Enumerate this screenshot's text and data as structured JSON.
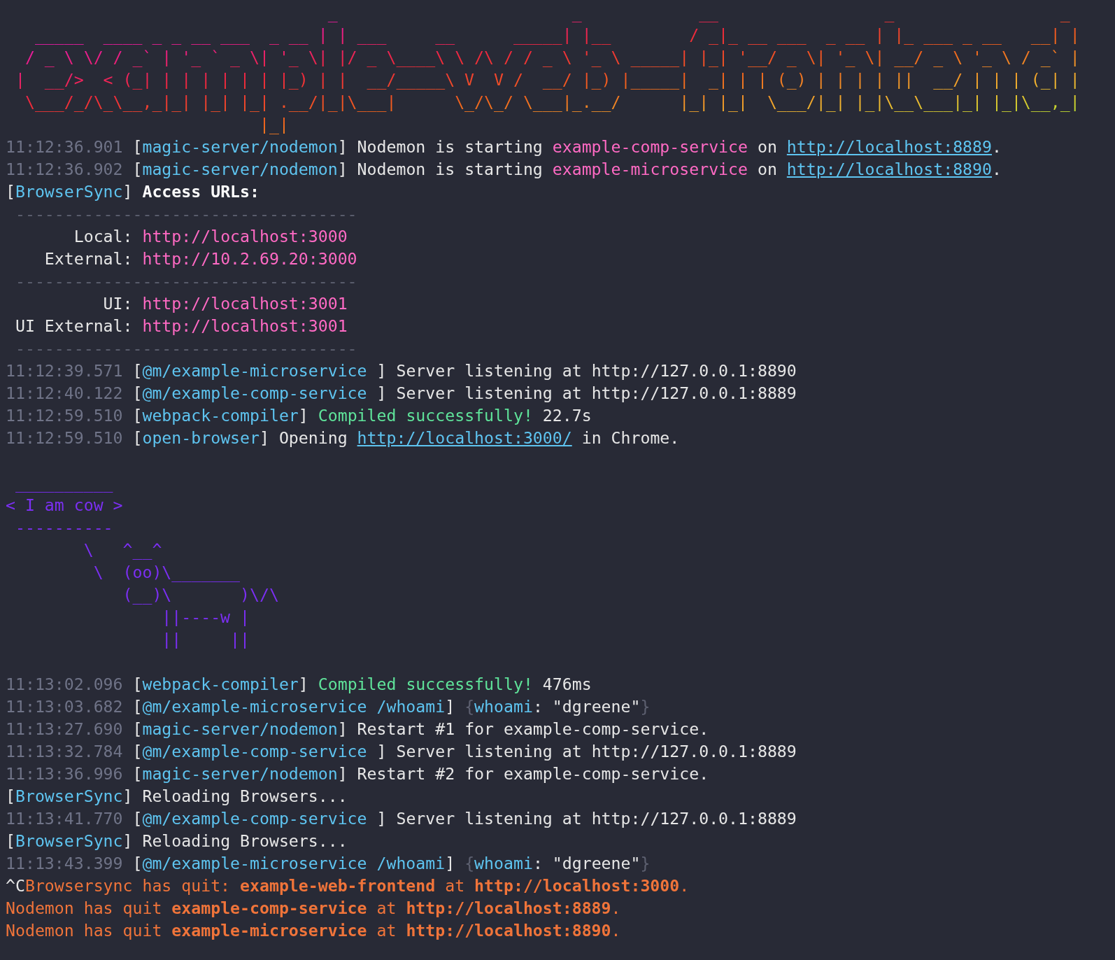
{
  "banner": [
    "                                 _                        _            __                 _                 _",
    "   _____  ____ _ _ __ ___  _ __ | | ___     __      _____| |__        / _|_ __ ___  _ __ | |_ ___ _ __   __| |",
    "  / _ \\ \\/ / _` | '_ ` _ \\| '_ \\| |/ _ \\____\\ \\ /\\ / / _ \\ '_ \\ _____| |_| '__/ _ \\| '_ \\| __/ _ \\ '_ \\ / _` |",
    " |  __/>  < (_| | | | | | | |_) | |  __/_____\\ V  V /  __/ |_) |_____|  _| | | (_) | | | | ||  __/ | | | (_| |",
    "  \\___/_/\\_\\__,_|_| |_| |_| .__/|_|\\___|      \\_/\\_/ \\___|_.__/      |_| |_|  \\___/|_| |_|\\__\\___|_| |_|\\__,_|",
    "                          |_|"
  ],
  "lines": [
    {
      "kind": "log",
      "segments": [
        {
          "kind": "time",
          "text": "11:12:36.901"
        },
        {
          "kind": "plain",
          "text": " ["
        },
        {
          "kind": "tag",
          "text": "magic-server/nodemon"
        },
        {
          "kind": "plain",
          "text": "] Nodemon is starting "
        },
        {
          "kind": "pink",
          "text": "example-comp-service"
        },
        {
          "kind": "plain",
          "text": " on "
        },
        {
          "kind": "link",
          "text": "http://localhost:8889"
        },
        {
          "kind": "plain",
          "text": "."
        }
      ]
    },
    {
      "kind": "log",
      "segments": [
        {
          "kind": "time",
          "text": "11:12:36.902"
        },
        {
          "kind": "plain",
          "text": " ["
        },
        {
          "kind": "tag",
          "text": "magic-server/nodemon"
        },
        {
          "kind": "plain",
          "text": "] Nodemon is starting "
        },
        {
          "kind": "pink",
          "text": "example-microservice"
        },
        {
          "kind": "plain",
          "text": " on "
        },
        {
          "kind": "link",
          "text": "http://localhost:8890"
        },
        {
          "kind": "plain",
          "text": "."
        }
      ]
    },
    {
      "kind": "log",
      "segments": [
        {
          "kind": "plain",
          "text": "["
        },
        {
          "kind": "tag",
          "text": "BrowserSync"
        },
        {
          "kind": "plain",
          "text": "] "
        },
        {
          "kind": "bold",
          "text": "Access URLs:"
        }
      ]
    },
    {
      "kind": "log",
      "segments": [
        {
          "kind": "dim",
          "text": " -----------------------------------"
        }
      ]
    },
    {
      "kind": "log",
      "segments": [
        {
          "kind": "plain",
          "text": "       Local: "
        },
        {
          "kind": "pink",
          "text": "http://localhost:3000"
        }
      ]
    },
    {
      "kind": "log",
      "segments": [
        {
          "kind": "plain",
          "text": "    External: "
        },
        {
          "kind": "pink",
          "text": "http://10.2.69.20:3000"
        }
      ]
    },
    {
      "kind": "log",
      "segments": [
        {
          "kind": "dim",
          "text": " -----------------------------------"
        }
      ]
    },
    {
      "kind": "log",
      "segments": [
        {
          "kind": "plain",
          "text": "          UI: "
        },
        {
          "kind": "pink",
          "text": "http://localhost:3001"
        }
      ]
    },
    {
      "kind": "log",
      "segments": [
        {
          "kind": "plain",
          "text": " UI External: "
        },
        {
          "kind": "pink",
          "text": "http://localhost:3001"
        }
      ]
    },
    {
      "kind": "log",
      "segments": [
        {
          "kind": "dim",
          "text": " -----------------------------------"
        }
      ]
    },
    {
      "kind": "log",
      "segments": [
        {
          "kind": "time",
          "text": "11:12:39.571"
        },
        {
          "kind": "plain",
          "text": " ["
        },
        {
          "kind": "tag",
          "text": "@m/example-microservice"
        },
        {
          "kind": "plain",
          "text": " ] Server listening at http://127.0.0.1:8890"
        }
      ]
    },
    {
      "kind": "log",
      "segments": [
        {
          "kind": "time",
          "text": "11:12:40.122"
        },
        {
          "kind": "plain",
          "text": " ["
        },
        {
          "kind": "tag",
          "text": "@m/example-comp-service"
        },
        {
          "kind": "plain",
          "text": " ] Server listening at http://127.0.0.1:8889"
        }
      ]
    },
    {
      "kind": "log",
      "segments": [
        {
          "kind": "time",
          "text": "11:12:59.510"
        },
        {
          "kind": "plain",
          "text": " ["
        },
        {
          "kind": "tag",
          "text": "webpack-compiler"
        },
        {
          "kind": "plain",
          "text": "] "
        },
        {
          "kind": "green",
          "text": "Compiled successfully!"
        },
        {
          "kind": "plain",
          "text": " 22.7s"
        }
      ]
    },
    {
      "kind": "log",
      "segments": [
        {
          "kind": "time",
          "text": "11:12:59.510"
        },
        {
          "kind": "plain",
          "text": " ["
        },
        {
          "kind": "tag",
          "text": "open-browser"
        },
        {
          "kind": "plain",
          "text": "] Opening "
        },
        {
          "kind": "link",
          "text": "http://localhost:3000/"
        },
        {
          "kind": "plain",
          "text": " in Chrome."
        }
      ]
    },
    {
      "kind": "blank"
    },
    {
      "kind": "cowsay",
      "art": [
        " __________",
        "< I am cow >",
        " ----------",
        "        \\   ^__^",
        "         \\  (oo)\\_______",
        "            (__)\\       )\\/\\",
        "                ||----w |",
        "                ||     ||"
      ]
    },
    {
      "kind": "blank"
    },
    {
      "kind": "log",
      "segments": [
        {
          "kind": "time",
          "text": "11:13:02.096"
        },
        {
          "kind": "plain",
          "text": " ["
        },
        {
          "kind": "tag",
          "text": "webpack-compiler"
        },
        {
          "kind": "plain",
          "text": "] "
        },
        {
          "kind": "green",
          "text": "Compiled successfully!"
        },
        {
          "kind": "plain",
          "text": " 476ms"
        }
      ]
    },
    {
      "kind": "log",
      "segments": [
        {
          "kind": "time",
          "text": "11:13:03.682"
        },
        {
          "kind": "plain",
          "text": " ["
        },
        {
          "kind": "tag",
          "text": "@m/example-microservice /whoami"
        },
        {
          "kind": "plain",
          "text": "] "
        },
        {
          "kind": "dim",
          "text": "{"
        },
        {
          "kind": "tag",
          "text": "whoami"
        },
        {
          "kind": "plain",
          "text": ": \"dgreene\""
        },
        {
          "kind": "dim",
          "text": "}"
        }
      ]
    },
    {
      "kind": "log",
      "segments": [
        {
          "kind": "time",
          "text": "11:13:27.690"
        },
        {
          "kind": "plain",
          "text": " ["
        },
        {
          "kind": "tag",
          "text": "magic-server/nodemon"
        },
        {
          "kind": "plain",
          "text": "] Restart #1 for example-comp-service."
        }
      ]
    },
    {
      "kind": "log",
      "segments": [
        {
          "kind": "time",
          "text": "11:13:32.784"
        },
        {
          "kind": "plain",
          "text": " ["
        },
        {
          "kind": "tag",
          "text": "@m/example-comp-service"
        },
        {
          "kind": "plain",
          "text": " ] Server listening at http://127.0.0.1:8889"
        }
      ]
    },
    {
      "kind": "log",
      "segments": [
        {
          "kind": "time",
          "text": "11:13:36.996"
        },
        {
          "kind": "plain",
          "text": " ["
        },
        {
          "kind": "tag",
          "text": "magic-server/nodemon"
        },
        {
          "kind": "plain",
          "text": "] Restart #2 for example-comp-service."
        }
      ]
    },
    {
      "kind": "log",
      "segments": [
        {
          "kind": "plain",
          "text": "["
        },
        {
          "kind": "tag",
          "text": "BrowserSync"
        },
        {
          "kind": "plain",
          "text": "] Reloading Browsers..."
        }
      ]
    },
    {
      "kind": "log",
      "segments": [
        {
          "kind": "time",
          "text": "11:13:41.770"
        },
        {
          "kind": "plain",
          "text": " ["
        },
        {
          "kind": "tag",
          "text": "@m/example-comp-service"
        },
        {
          "kind": "plain",
          "text": " ] Server listening at http://127.0.0.1:8889"
        }
      ]
    },
    {
      "kind": "log",
      "segments": [
        {
          "kind": "plain",
          "text": "["
        },
        {
          "kind": "tag",
          "text": "BrowserSync"
        },
        {
          "kind": "plain",
          "text": "] Reloading Browsers..."
        }
      ]
    },
    {
      "kind": "log",
      "segments": [
        {
          "kind": "time",
          "text": "11:13:43.399"
        },
        {
          "kind": "plain",
          "text": " ["
        },
        {
          "kind": "tag",
          "text": "@m/example-microservice /whoami"
        },
        {
          "kind": "plain",
          "text": "] "
        },
        {
          "kind": "dim",
          "text": "{"
        },
        {
          "kind": "tag",
          "text": "whoami"
        },
        {
          "kind": "plain",
          "text": ": \"dgreene\""
        },
        {
          "kind": "dim",
          "text": "}"
        }
      ]
    },
    {
      "kind": "log",
      "segments": [
        {
          "kind": "plain",
          "text": "^C"
        },
        {
          "kind": "quit",
          "text": "Browsersync has quit: "
        },
        {
          "kind": "quitbold",
          "text": "example-web-frontend"
        },
        {
          "kind": "quit",
          "text": " at "
        },
        {
          "kind": "quitbold",
          "text": "http://localhost:3000"
        },
        {
          "kind": "quit",
          "text": "."
        }
      ]
    },
    {
      "kind": "log",
      "segments": [
        {
          "kind": "quit",
          "text": "Nodemon has quit "
        },
        {
          "kind": "quitbold",
          "text": "example-comp-service"
        },
        {
          "kind": "quit",
          "text": " at "
        },
        {
          "kind": "quitbold",
          "text": "http://localhost:8889"
        },
        {
          "kind": "quit",
          "text": "."
        }
      ]
    },
    {
      "kind": "log",
      "segments": [
        {
          "kind": "quit",
          "text": "Nodemon has quit "
        },
        {
          "kind": "quitbold",
          "text": "example-microservice"
        },
        {
          "kind": "quit",
          "text": " at "
        },
        {
          "kind": "quitbold",
          "text": "http://localhost:8890"
        },
        {
          "kind": "quit",
          "text": "."
        }
      ]
    }
  ]
}
